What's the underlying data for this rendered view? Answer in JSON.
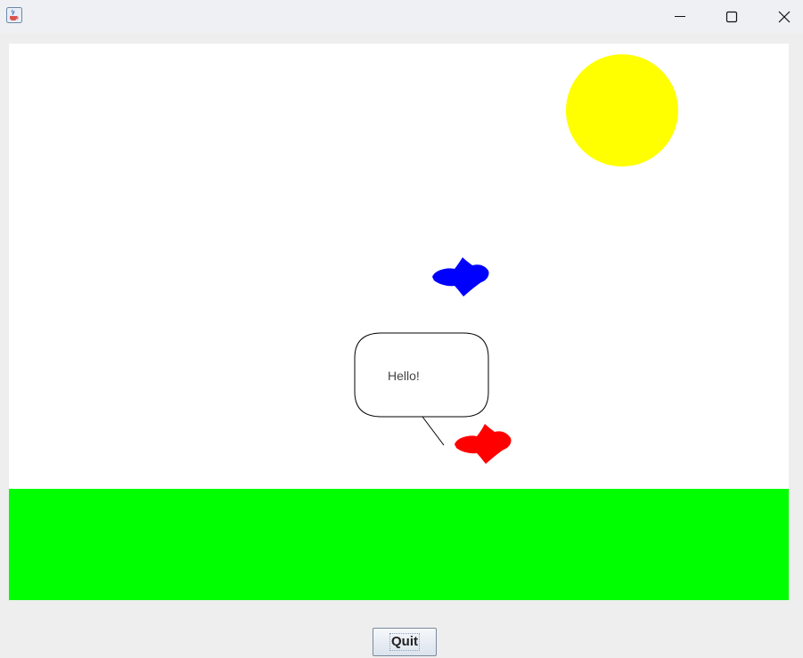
{
  "window": {
    "controls": {
      "minimize_icon": "minimize-icon",
      "maximize_icon": "maximize-icon",
      "close_icon": "close-icon"
    },
    "app_icon": "java-cup-icon"
  },
  "scene": {
    "sky_color": "#ffffff",
    "grass_color": "#00ff00",
    "sun_color": "#ffff00",
    "bubble": {
      "text": "Hello!"
    },
    "fish": [
      {
        "name": "blue-fish",
        "color": "#0000ff"
      },
      {
        "name": "red-fish",
        "color": "#ff0000"
      }
    ]
  },
  "footer": {
    "quit_label": "Quit"
  }
}
